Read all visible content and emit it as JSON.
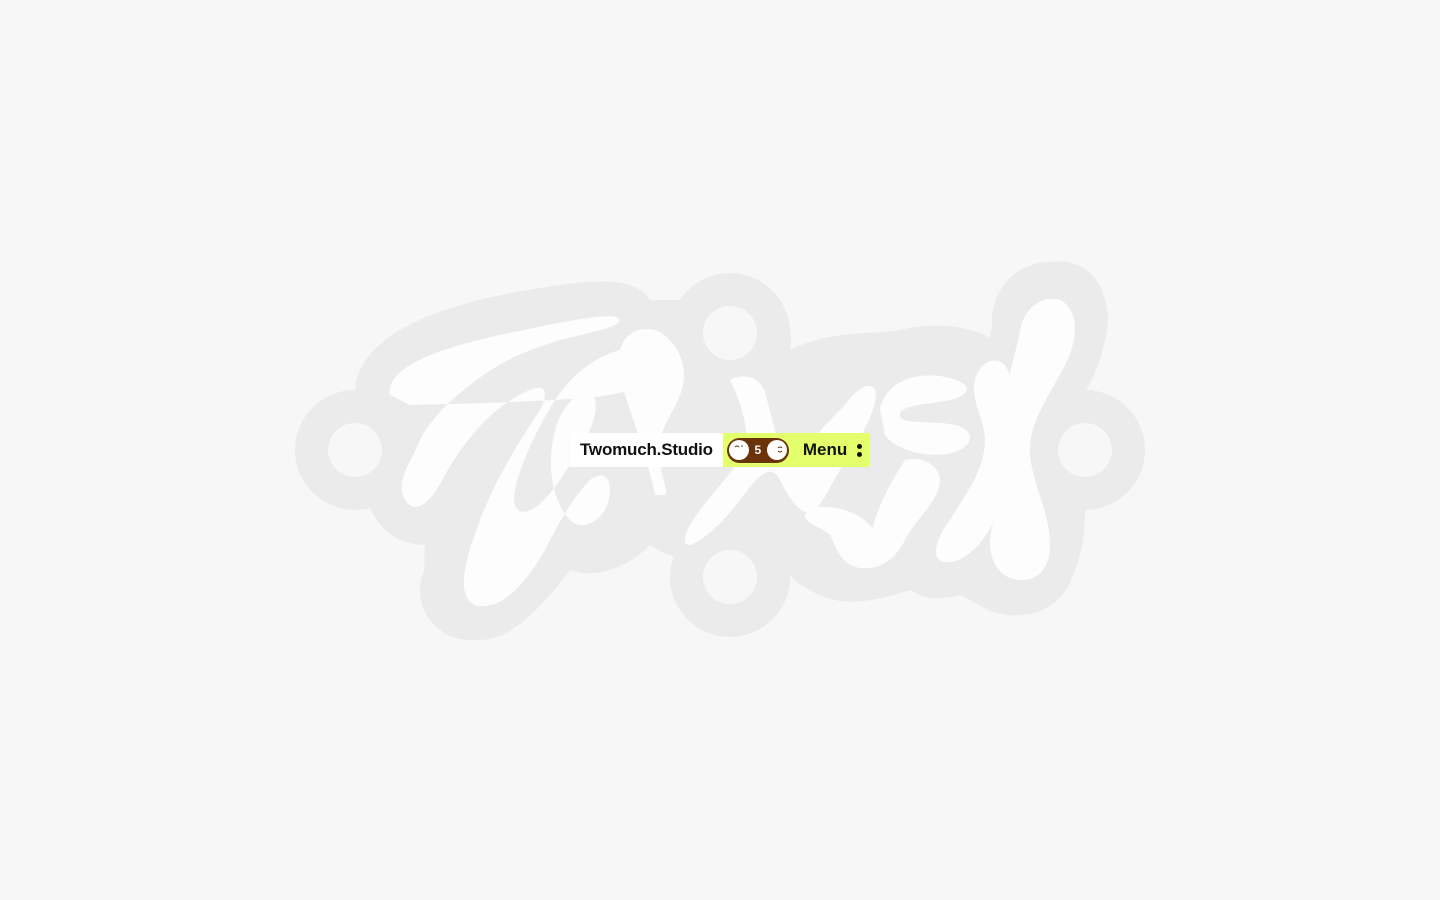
{
  "brand": {
    "name": "Twomuch.Studio"
  },
  "toggle": {
    "count": "5",
    "left_icon": "sleepy-face-icon",
    "right_icon": "smiling-face-icon"
  },
  "menu": {
    "label": "Menu",
    "icon": "more-vertical-icon"
  },
  "colors": {
    "background": "#f7f7f7",
    "logo_outline": "#ebebeb",
    "logo_fill": "#fdfdfd",
    "accent": "#e3ff6b",
    "toggle": "#6b3309"
  }
}
